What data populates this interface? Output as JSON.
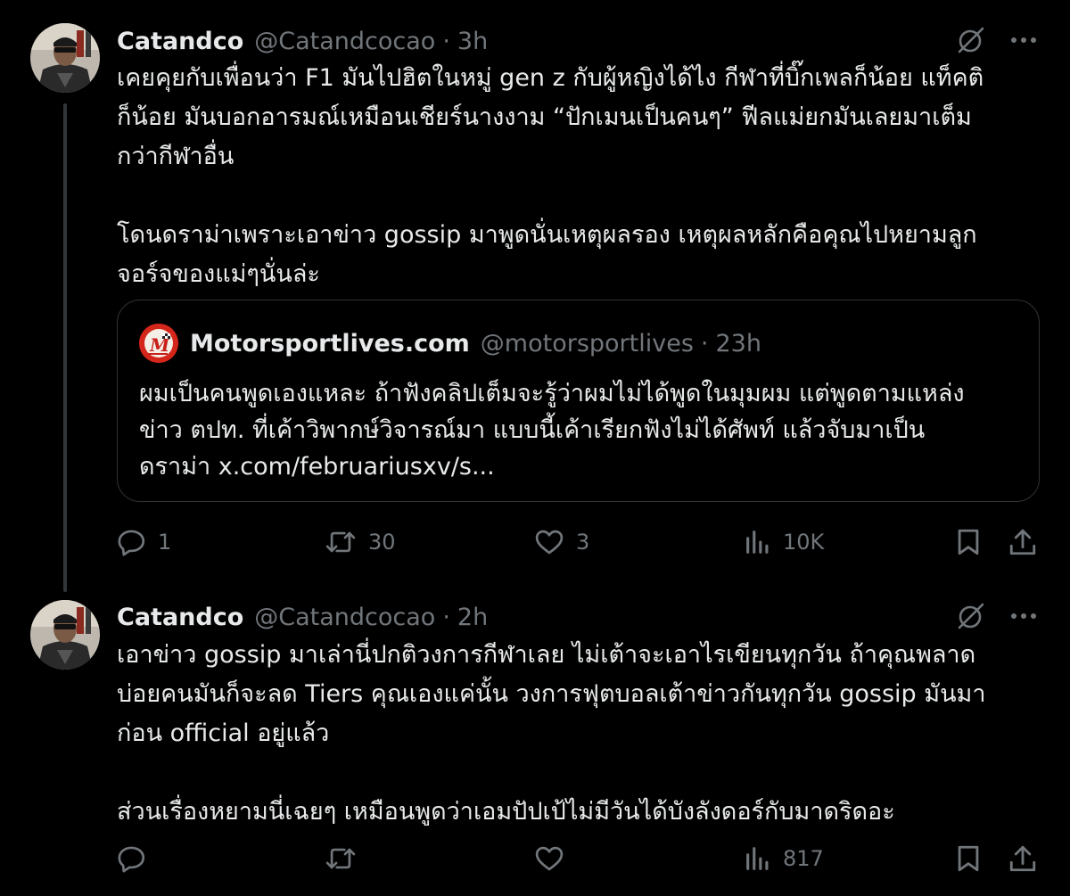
{
  "tweets": [
    {
      "name": "Catandco",
      "handle": "@Catandcocao",
      "sep": "·",
      "time": "3h",
      "text_lines": [
        "เคยคุยกับเพื่อนว่า F1 มันไปฮิตในหมู่ gen z กับผู้หญิงได้ไง กีฬาที่บิ๊กเพลก็น้อย แท็คติ",
        "ก็น้อย มันบอกอารมณ์เหมือนเชียร์นางงาม “ปักเมนเป็นคนๆ” ฟีลแม่ยกมันเลยมาเต็ม",
        "กว่ากีฬาอื่น",
        "โดนดราม่าเพราะเอาข่าว gossip มาพูดนั่นเหตุผลรอง เหตุผลหลักคือคุณไปหยามลูก",
        "จอร์จของแม่ๆนั่นล่ะ"
      ],
      "quote": {
        "name": "Motorsportlives.com",
        "handle": "@motorsportlives",
        "sep": "·",
        "time": "23h",
        "text_lines": [
          "ผมเป็นคนพูดเองแหละ ถ้าฟังคลิปเต็มจะรู้ว่าผมไม่ได้พูดในมุมผม แต่พูดตามแหล่ง",
          "ข่าว ตปท. ที่เค้าวิพากษ์วิจารณ์มา แบบนี้เค้าเรียกฟังไม่ได้ศัพท์ แล้วจับมาเป็น",
          "ดราม่า x.com/februariusxv/s..."
        ]
      },
      "actions": {
        "replies": "1",
        "reposts": "30",
        "likes": "3",
        "views": "10K"
      }
    },
    {
      "name": "Catandco",
      "handle": "@Catandcocao",
      "sep": "·",
      "time": "2h",
      "text_lines": [
        "เอาข่าว gossip มาเล่านี่ปกติวงการกีฬาเลย ไม่เต้าจะเอาไรเขียนทุกวัน ถ้าคุณพลาด",
        "บ่อยคนมันก็จะลด Tiers คุณเองแค่นั้น วงการฟุตบอลเต้าข่าวกันทุกวัน gossip มันมา",
        "ก่อน official อยู่แล้ว",
        "ส่วนเรื่องหยามนี่เฉยๆ เหมือนพูดว่าเอมปัปเป้ไม่มีวันได้บังลังดอร์กับมาดริดอะ"
      ],
      "actions": {
        "replies": "",
        "reposts": "",
        "likes": "",
        "views": "817"
      }
    }
  ],
  "icons": {
    "grok": "grok-icon",
    "more": "more-icon",
    "reply": "reply-icon",
    "repost": "repost-icon",
    "like": "like-icon",
    "views": "views-icon",
    "bookmark": "bookmark-icon",
    "share": "share-icon"
  },
  "colors": {
    "background": "#000000",
    "text": "#e7e9ea",
    "secondary": "#71767b",
    "border": "#2f3336",
    "logo_red": "#d4261a"
  }
}
